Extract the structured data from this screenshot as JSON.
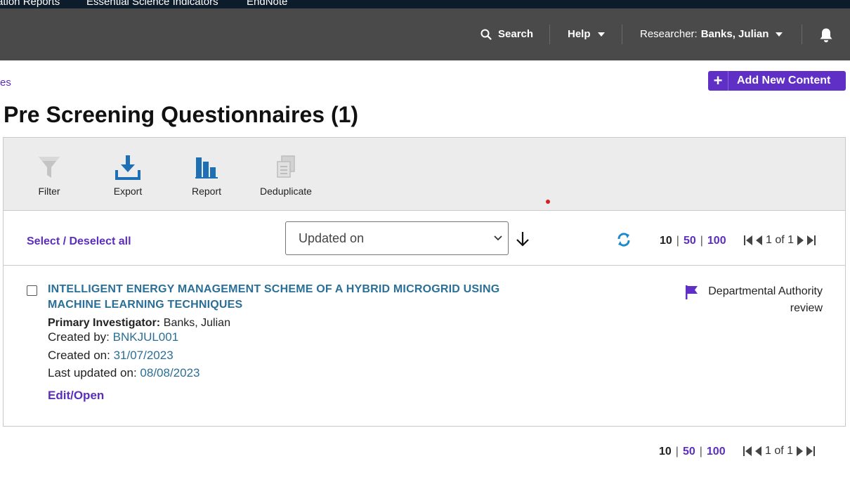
{
  "topnav": {
    "items": [
      "ation Reports",
      "Essential Science Indicators",
      "EndNote"
    ]
  },
  "header": {
    "search_label": "Search",
    "help_label": "Help",
    "researcher_prefix": "Researcher:",
    "researcher_name": "Banks, Julian"
  },
  "breadcrumb": {
    "text": "es"
  },
  "add_button": {
    "label": "Add New Content"
  },
  "page": {
    "title": "Pre Screening Questionnaires (1)"
  },
  "toolbar": {
    "filter": "Filter",
    "export": "Export",
    "report": "Report",
    "deduplicate": "Deduplicate"
  },
  "sort": {
    "select_all": "Select / Deselect all",
    "sort_value": "Updated on"
  },
  "pagination": {
    "sizes": [
      "10",
      "50",
      "100"
    ],
    "current_size": "10",
    "page_info": "1 of 1"
  },
  "record": {
    "title": "INTELLIGENT ENERGY MANAGEMENT SCHEME OF A HYBRID MICROGRID USING MACHINE LEARNING TECHNIQUES",
    "pi_label": "Primary Investigator:",
    "pi_value": "Banks, Julian",
    "created_by_label": "Created by:",
    "created_by_value": "BNKJUL001",
    "created_on_label": "Created on:",
    "created_on_value": "31/07/2023",
    "updated_label": "Last updated on:",
    "updated_value": "08/08/2023",
    "edit_label": "Edit/Open",
    "status": "Departmental Authority review"
  },
  "colors": {
    "accent_purple": "#5f2fc6",
    "link_blue": "#2a6f97",
    "header_bg": "#4a4a4a",
    "topbar_bg": "#0d1c2b"
  }
}
